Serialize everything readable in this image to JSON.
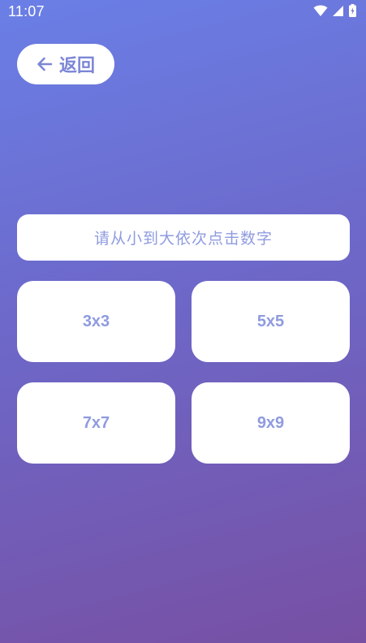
{
  "status_bar": {
    "time": "11:07",
    "icons": [
      "wifi-icon",
      "signal-icon",
      "battery-icon"
    ]
  },
  "header": {
    "back_label": "返回",
    "back_icon": "arrow-left-icon"
  },
  "main": {
    "instruction": "请从小到大依次点击数字",
    "grid_options": [
      "3x3",
      "5x5",
      "7x7",
      "9x9"
    ]
  },
  "colors": {
    "gradient_start": "#6a7fe6",
    "gradient_end": "#7750a3",
    "accent_text": "#8f9be0",
    "card_bg": "#ffffff"
  }
}
